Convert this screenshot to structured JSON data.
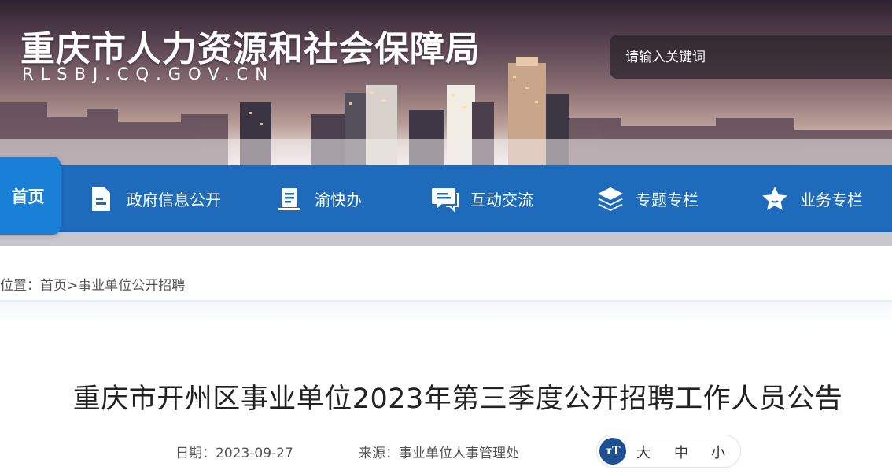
{
  "header": {
    "site_title": "重庆市人力资源和社会保障局",
    "site_domain": "RLSBJ.CQ.GOV.CN"
  },
  "search": {
    "placeholder": "请输入关键词"
  },
  "nav": {
    "home_label": "首页",
    "items": [
      {
        "label": "政府信息公开",
        "icon": "document-icon"
      },
      {
        "label": "渝快办",
        "icon": "book-icon"
      },
      {
        "label": "互动交流",
        "icon": "chat-icon"
      },
      {
        "label": "专题专栏",
        "icon": "layers-icon"
      },
      {
        "label": "业务专栏",
        "icon": "star-icon"
      }
    ]
  },
  "breadcrumb": {
    "prefix": "位置：",
    "home": "首页",
    "separator": ">",
    "current": "事业单位公开招聘"
  },
  "article": {
    "title": "重庆市开州区事业单位2023年第三季度公开招聘工作人员公告",
    "date_label": "日期：",
    "date": "2023-09-27",
    "source_label": "来源：",
    "source": "事业单位人事管理处",
    "font_size": {
      "icon_text": "тT",
      "large": "大",
      "medium": "中",
      "small": "小"
    }
  },
  "colors": {
    "nav_bg": "#1e6bbb",
    "nav_active_bg": "#1a7fd6",
    "text_primary": "#222222",
    "text_meta": "#555555"
  }
}
